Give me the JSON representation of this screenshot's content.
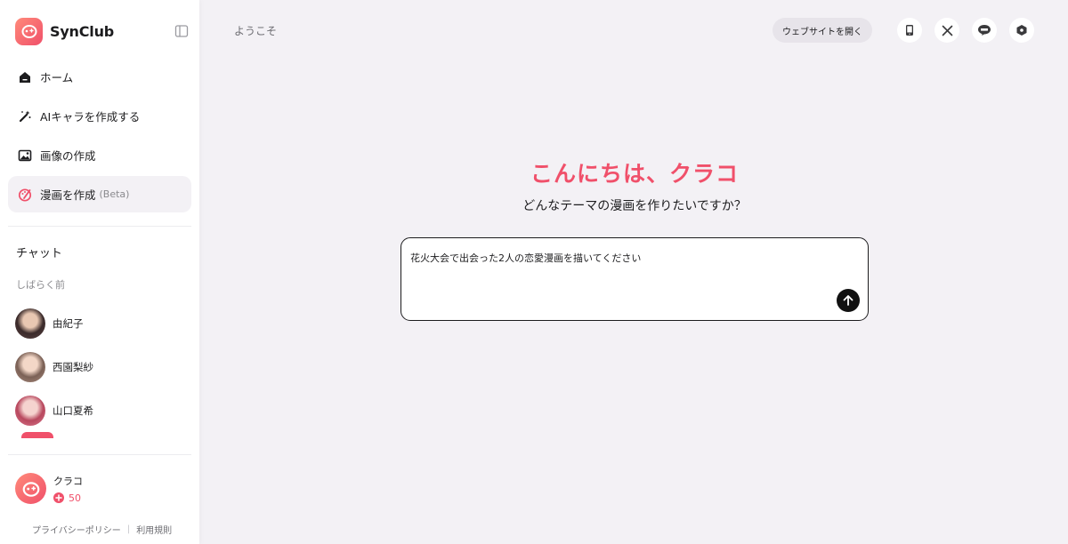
{
  "brand": {
    "name": "SynClub"
  },
  "nav": {
    "items": [
      {
        "label": "ホーム",
        "icon": "home-icon"
      },
      {
        "label": "AIキャラを作成する",
        "icon": "magic-wand-icon"
      },
      {
        "label": "画像の作成",
        "icon": "image-icon"
      },
      {
        "label": "漫画を作成",
        "badge": "(Beta)",
        "icon": "palette-icon",
        "active": true
      }
    ]
  },
  "chat": {
    "heading": "チャット",
    "section_label": "しばらく前",
    "items": [
      {
        "name": "由紀子"
      },
      {
        "name": "西園梨紗"
      },
      {
        "name": "山口夏希"
      }
    ]
  },
  "user": {
    "name": "クラコ",
    "points": "50"
  },
  "footer": {
    "privacy": "プライバシーポリシー",
    "terms": "利用規則"
  },
  "header": {
    "welcome": "ようこそ",
    "open_site_label": "ウェブサイトを開く",
    "icons": [
      "phone-icon",
      "x-logo-icon",
      "line-logo-icon",
      "shield-icon"
    ]
  },
  "main": {
    "greeting": "こんにちは、クラコ",
    "question": "どんなテーマの漫画を作りたいですか？",
    "prompt_value": "花火大会で出会った2人の恋愛漫画を描いてください"
  },
  "colors": {
    "accent": "#f0506a",
    "background": "#f3f1f5",
    "sidebar": "#ffffff"
  }
}
